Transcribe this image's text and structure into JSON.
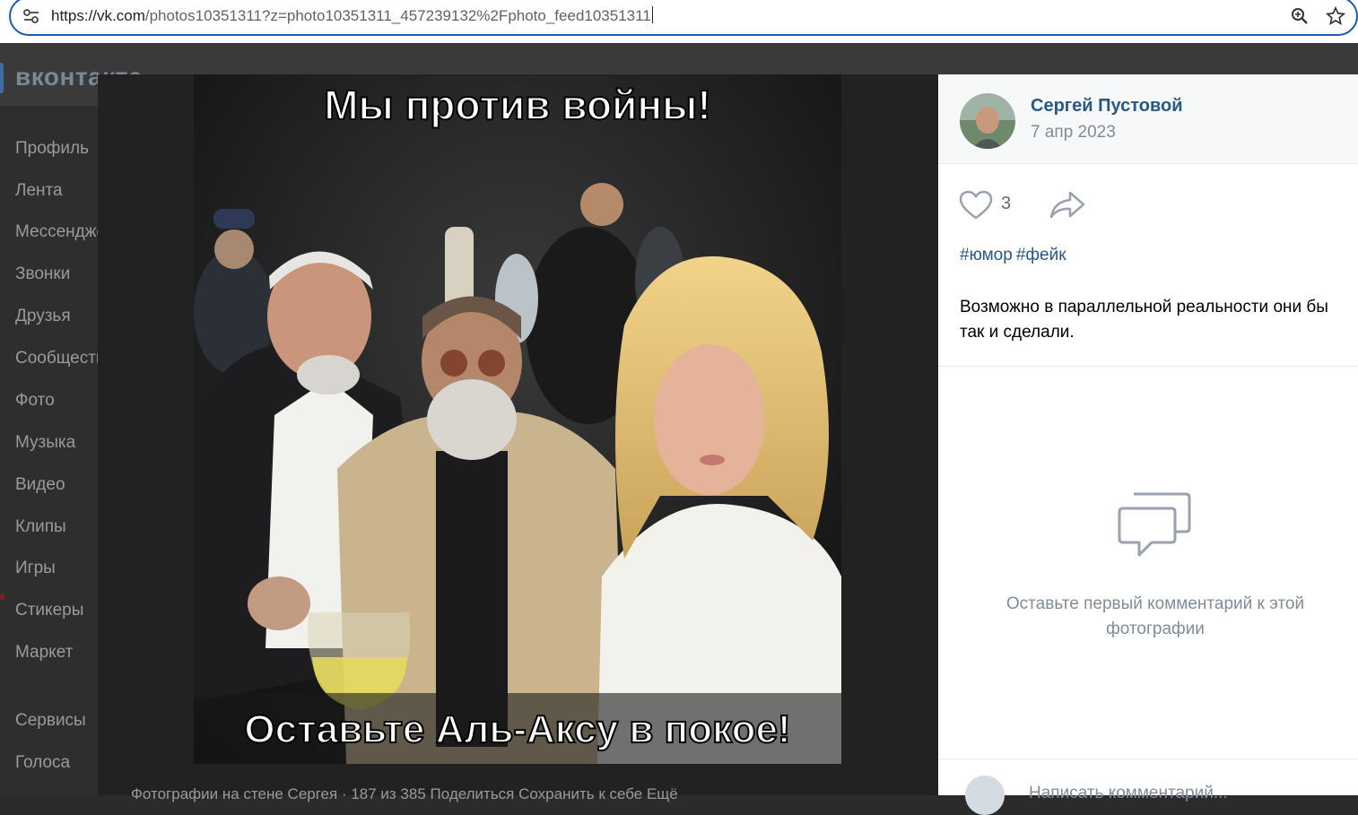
{
  "browser": {
    "url_host": "https://vk.com",
    "url_rest": "/photos10351311?z=photo10351311_457239132%2Fphoto_feed10351311",
    "icons": [
      "tune-icon",
      "zoom-icon",
      "star-icon"
    ]
  },
  "vk": {
    "logo": "вконтакте",
    "sidebar": [
      "Профиль",
      "Лента",
      "Мессенджер",
      "Звонки",
      "Друзья",
      "Сообщества",
      "Фото",
      "Музыка",
      "Видео",
      "Клипы",
      "Игры",
      "Стикеры",
      "Маркет",
      "Сервисы",
      "Голоса"
    ]
  },
  "photo": {
    "top_caption": "Мы против войны!",
    "bottom_caption": "Оставьте Аль-Аксу в покое!",
    "footer": "Фотографии на стене Сергея · 187 из 385    Поделиться    Сохранить к себе    Ещё"
  },
  "panel": {
    "author": "Сергей Пустовой",
    "date": "7 апр 2023",
    "likes": "3",
    "tags": [
      "#юмор",
      "#фейк"
    ],
    "description": "Возможно в параллельной реальности они бы так и сделали.",
    "empty_comments": "Оставьте первый комментарий к этой фотографии",
    "comment_placeholder": "Написать комментарий..."
  },
  "colors": {
    "link": "#2a5885",
    "muted": "#818c99",
    "focus": "#1a5bb4"
  }
}
